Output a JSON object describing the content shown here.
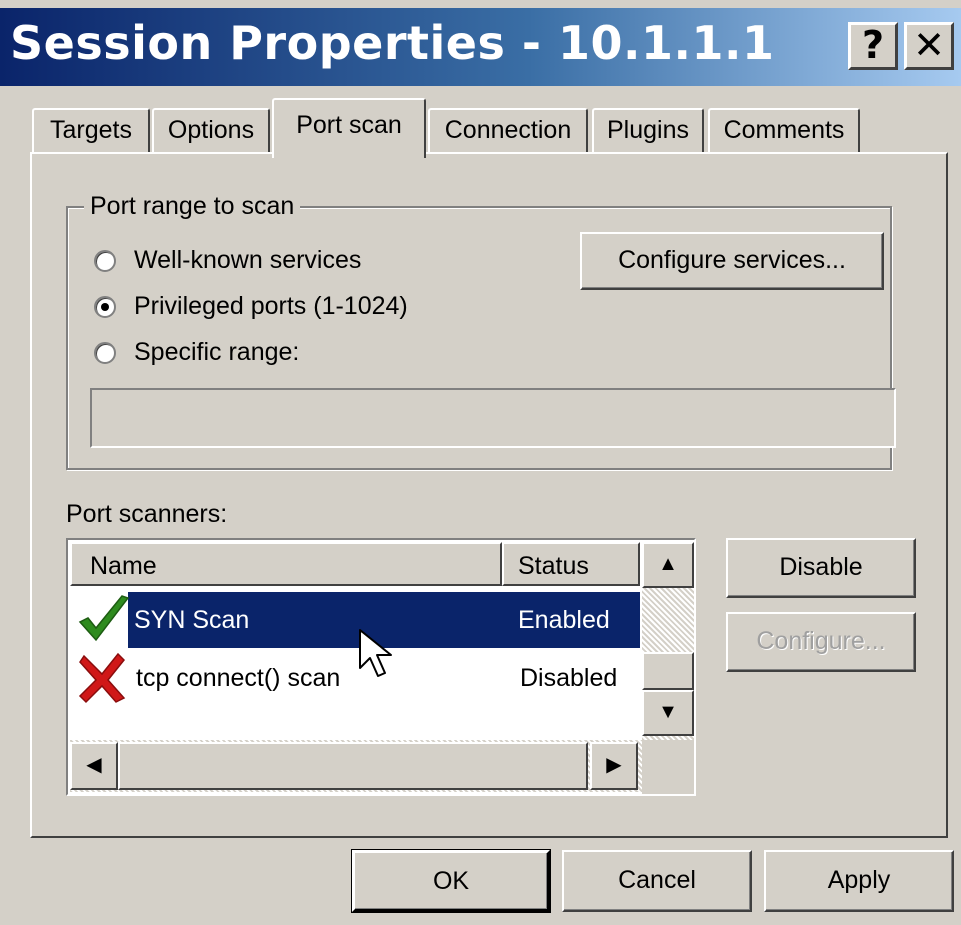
{
  "window": {
    "title": "Session Properties - 10.1.1.1",
    "help_label": "?",
    "close_label": "✕"
  },
  "tabs": [
    {
      "label": "Targets"
    },
    {
      "label": "Options"
    },
    {
      "label": "Port scan"
    },
    {
      "label": "Connection"
    },
    {
      "label": "Plugins"
    },
    {
      "label": "Comments"
    }
  ],
  "active_tab": "Port scan",
  "port_range": {
    "legend": "Port range to scan",
    "options": [
      {
        "label": "Well-known services",
        "selected": false
      },
      {
        "label": "Privileged ports (1-1024)",
        "selected": true
      },
      {
        "label": "Specific range:",
        "selected": false
      }
    ],
    "configure_services_label": "Configure services...",
    "specific_range_value": ""
  },
  "scanners": {
    "label": "Port scanners:",
    "columns": [
      "Name",
      "Status"
    ],
    "rows": [
      {
        "name": "SYN Scan",
        "status": "Enabled",
        "icon": "check-icon",
        "selected": true
      },
      {
        "name": "tcp connect() scan",
        "status": "Disabled",
        "icon": "cross-icon",
        "selected": false
      }
    ],
    "disable_label": "Disable",
    "configure_label": "Configure..."
  },
  "footer": {
    "ok_label": "OK",
    "cancel_label": "Cancel",
    "apply_label": "Apply"
  },
  "colors": {
    "face": "#d4d0c8",
    "title_gradient_start": "#0a246a",
    "selection": "#0a246a",
    "check": "#2e8b1e",
    "cross": "#d01818"
  }
}
